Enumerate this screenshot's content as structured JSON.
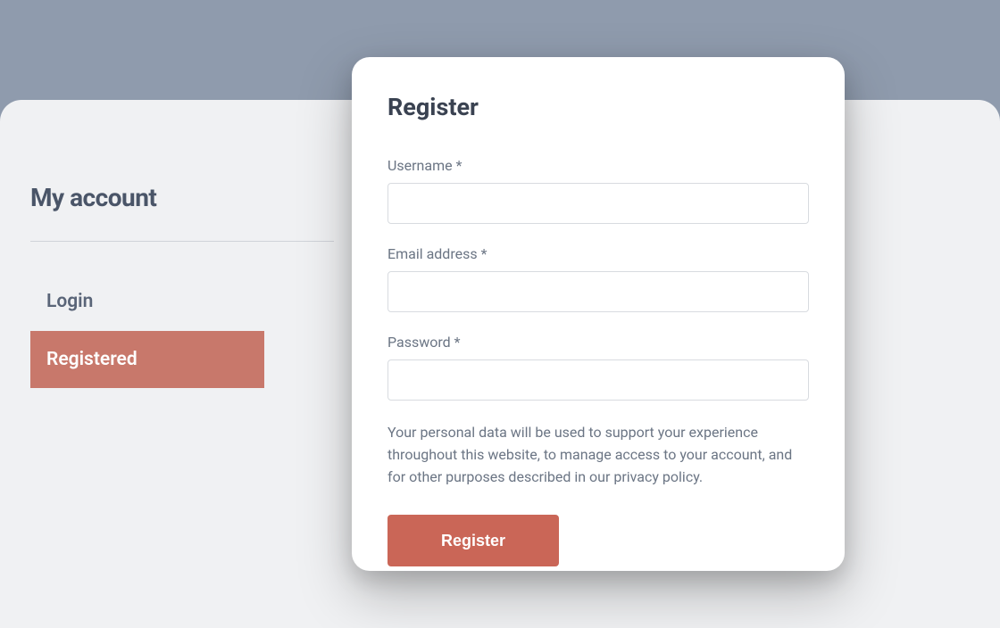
{
  "page": {
    "title": "My account"
  },
  "tabs": {
    "login": "Login",
    "registered": "Registered"
  },
  "modal": {
    "title": "Register",
    "fields": {
      "username_label": "Username *",
      "email_label": "Email address *",
      "password_label": "Password *"
    },
    "privacy_text_part1": "Your personal data will be used to support your experience throughout this website, to manage access to your account, and for other purposes described in our ",
    "privacy_link_text": "privacy policy",
    "privacy_text_part2": ".",
    "button_label": "Register"
  }
}
